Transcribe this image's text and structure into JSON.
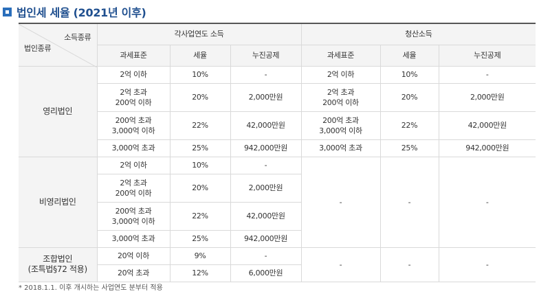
{
  "title": "법인세 세율 (2021년 이후)",
  "header": {
    "corner_top": "소득종류",
    "corner_bottom": "법인종류",
    "group1": "각사업연도 소득",
    "group2": "청산소득",
    "col_base": "과세표준",
    "col_rate": "세율",
    "col_deduction": "누진공제"
  },
  "categories": {
    "profit": "영리법인",
    "nonprofit": "비영리법인",
    "coop_line1": "조합법인",
    "coop_line2": "(조특법§72 적용)"
  },
  "profit_rows": [
    {
      "base": [
        "2억 이하"
      ],
      "rate": "10%",
      "ded": "-",
      "l_base": [
        "2억 이하"
      ],
      "l_rate": "10%",
      "l_ded": "-"
    },
    {
      "base": [
        "2억 초과",
        "200억 이하"
      ],
      "rate": "20%",
      "ded": "2,000만원",
      "l_base": [
        "2억 초과",
        "200억 이하"
      ],
      "l_rate": "20%",
      "l_ded": "2,000만원"
    },
    {
      "base": [
        "200억 초과",
        "3,000억 이하"
      ],
      "rate": "22%",
      "ded": "42,000만원",
      "l_base": [
        "200억 초과",
        "3,000억 이하"
      ],
      "l_rate": "22%",
      "l_ded": "42,000만원"
    },
    {
      "base": [
        "3,000억 초과"
      ],
      "rate": "25%",
      "ded": "942,000만원",
      "l_base": [
        "3,000억 초과"
      ],
      "l_rate": "25%",
      "l_ded": "942,000만원"
    }
  ],
  "nonprofit_rows": [
    {
      "base": [
        "2억 이하"
      ],
      "rate": "10%",
      "ded": "-"
    },
    {
      "base": [
        "2억 초과",
        "200억 이하"
      ],
      "rate": "20%",
      "ded": "2,000만원"
    },
    {
      "base": [
        "200억 초과",
        "3,000억 이하"
      ],
      "rate": "22%",
      "ded": "42,000만원"
    },
    {
      "base": [
        "3,000억 초과"
      ],
      "rate": "25%",
      "ded": "942,000만원"
    }
  ],
  "nonprofit_liq": {
    "base": "-",
    "rate": "-",
    "ded": "-"
  },
  "coop_rows": [
    {
      "base": [
        "20억 이하"
      ],
      "rate": "9%",
      "ded": "-"
    },
    {
      "base": [
        "20억 초과"
      ],
      "rate": "12%",
      "ded": "6,000만원"
    }
  ],
  "coop_liq": {
    "base": "-",
    "rate": "-",
    "ded": "-"
  },
  "footnote": "* 2018.1.1. 이후 개시하는 사업연도 분부터 적용"
}
